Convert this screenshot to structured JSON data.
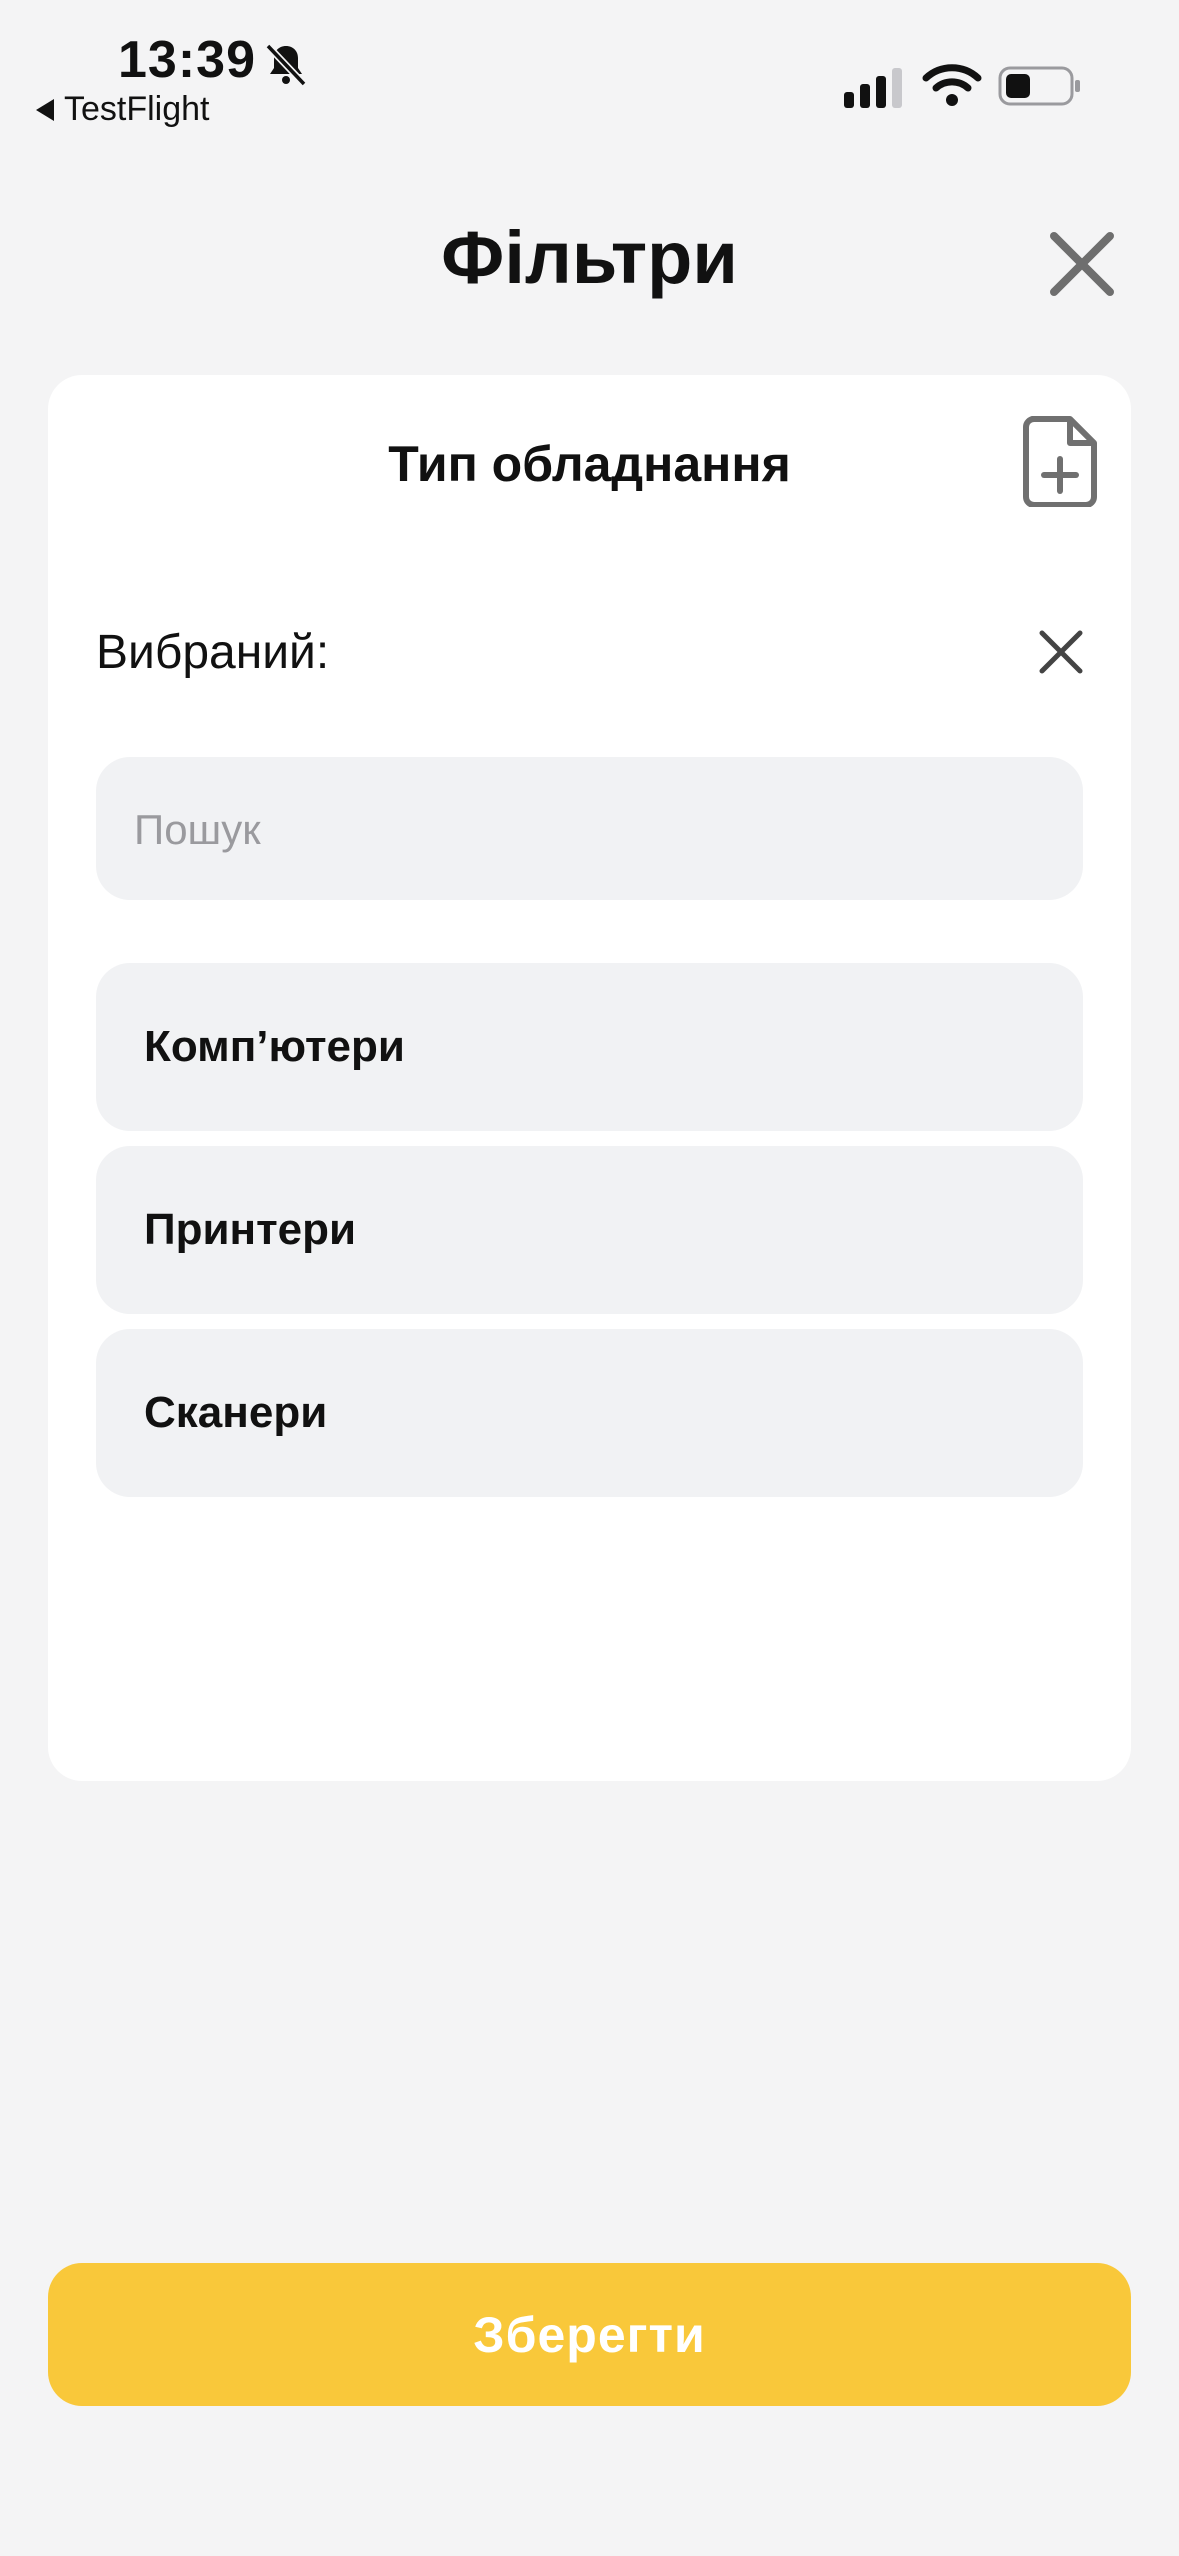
{
  "status_bar": {
    "time": "13:39",
    "back_app": "TestFlight"
  },
  "header": {
    "title": "Фільтри"
  },
  "card": {
    "section_title": "Тип обладнання",
    "selected_label": "Вибраний:",
    "search": {
      "placeholder": "Пошук",
      "value": ""
    },
    "options": [
      {
        "label": "Комп’ютери"
      },
      {
        "label": "Принтери"
      },
      {
        "label": "Сканери"
      }
    ]
  },
  "footer": {
    "save_label": "Зберегти"
  },
  "colors": {
    "background": "#f4f4f5",
    "card": "#ffffff",
    "field": "#f1f2f4",
    "accent": "#f9c83a",
    "icon_gray": "#707070"
  },
  "icons": [
    "bell-slash-icon",
    "back-arrow-icon",
    "signal-icon",
    "wifi-icon",
    "battery-icon",
    "close-icon",
    "file-add-icon",
    "clear-icon"
  ]
}
